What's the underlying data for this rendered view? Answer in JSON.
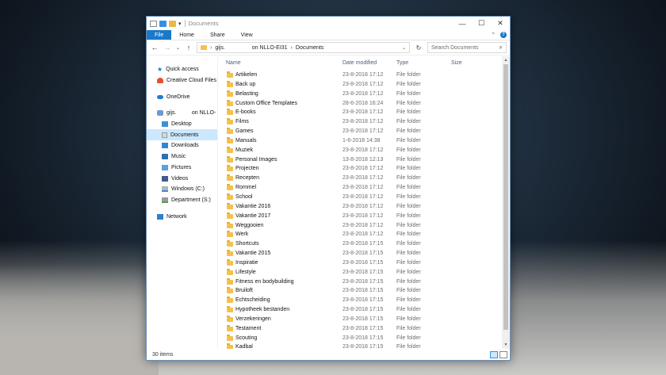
{
  "window": {
    "title": "Documents",
    "controls": {
      "minimize": "—",
      "maximize": "☐",
      "close": "✕"
    }
  },
  "ribbon": {
    "tabs": [
      "File",
      "Home",
      "Share",
      "View"
    ],
    "collapse": "⌃",
    "help": "?"
  },
  "address": {
    "back": "←",
    "forward": "→",
    "recent": "⌄",
    "up": "↑",
    "segments": [
      "gijs.",
      "on NLLO-EI31",
      "Documents"
    ],
    "dropdown": "⌄",
    "refresh": "↻",
    "search_placeholder": "Search Documents",
    "search_icon": "⌕"
  },
  "nav": {
    "items": [
      {
        "label": "Quick access",
        "icon": "star-icon"
      },
      {
        "label": "Creative Cloud Files",
        "icon": "creative-cloud-icon"
      },
      {
        "label": "OneDrive",
        "icon": "onedrive-icon"
      },
      {
        "label": "gijs.          on NLLO-",
        "icon": "user-folder-icon"
      },
      {
        "label": "Desktop",
        "icon": "desktop-icon"
      },
      {
        "label": "Documents",
        "icon": "documents-icon",
        "selected": true
      },
      {
        "label": "Downloads",
        "icon": "downloads-icon"
      },
      {
        "label": "Music",
        "icon": "music-icon"
      },
      {
        "label": "Pictures",
        "icon": "pictures-icon"
      },
      {
        "label": "Videos",
        "icon": "videos-icon"
      },
      {
        "label": "Windows (C:)",
        "icon": "drive-icon"
      },
      {
        "label": "Department (S:)",
        "icon": "network-drive-icon"
      },
      {
        "label": "Network",
        "icon": "network-icon"
      }
    ]
  },
  "columns": {
    "name": "Name",
    "date": "Date modified",
    "type": "Type",
    "size": "Size",
    "sort_indicator": "^"
  },
  "files": [
    {
      "name": "Artikelen",
      "date": "23-8-2018 17:12",
      "type": "File folder"
    },
    {
      "name": "Back up",
      "date": "23-8-2018 17:12",
      "type": "File folder"
    },
    {
      "name": "Belasting",
      "date": "23-8-2018 17:12",
      "type": "File folder"
    },
    {
      "name": "Custom Office Templates",
      "date": "28-6-2018 16:24",
      "type": "File folder"
    },
    {
      "name": "E-books",
      "date": "23-8-2018 17:12",
      "type": "File folder"
    },
    {
      "name": "Films",
      "date": "23-8-2018 17:12",
      "type": "File folder"
    },
    {
      "name": "Games",
      "date": "23-8-2018 17:12",
      "type": "File folder"
    },
    {
      "name": "Manuals",
      "date": "1-6-2018 14:38",
      "type": "File folder"
    },
    {
      "name": "Muziek",
      "date": "23-8-2018 17:12",
      "type": "File folder"
    },
    {
      "name": "Personal Images",
      "date": "13-8-2018 12:13",
      "type": "File folder"
    },
    {
      "name": "Projecten",
      "date": "23-8-2018 17:12",
      "type": "File folder"
    },
    {
      "name": "Recepten",
      "date": "23-8-2018 17:12",
      "type": "File folder"
    },
    {
      "name": "Rommel",
      "date": "23-8-2018 17:12",
      "type": "File folder"
    },
    {
      "name": "School",
      "date": "23-8-2018 17:12",
      "type": "File folder"
    },
    {
      "name": "Vakantie 2016",
      "date": "23-8-2018 17:12",
      "type": "File folder"
    },
    {
      "name": "Vakantie 2017",
      "date": "23-8-2018 17:12",
      "type": "File folder"
    },
    {
      "name": "Weggooien",
      "date": "23-8-2018 17:12",
      "type": "File folder"
    },
    {
      "name": "Werk",
      "date": "23-8-2018 17:12",
      "type": "File folder"
    },
    {
      "name": "Shortcuts",
      "date": "23-8-2018 17:15",
      "type": "File folder"
    },
    {
      "name": "Vakantie 2015",
      "date": "23-8-2018 17:15",
      "type": "File folder"
    },
    {
      "name": "Inspiratie",
      "date": "23-8-2018 17:15",
      "type": "File folder"
    },
    {
      "name": "Lifestyle",
      "date": "23-8-2018 17:15",
      "type": "File folder"
    },
    {
      "name": "Fitness en bodybuilding",
      "date": "23-8-2018 17:15",
      "type": "File folder"
    },
    {
      "name": "Bruiloft",
      "date": "23-8-2018 17:15",
      "type": "File folder"
    },
    {
      "name": "Echtscheiding",
      "date": "23-8-2018 17:15",
      "type": "File folder"
    },
    {
      "name": "Hypotheek bestanden",
      "date": "23-8-2018 17:15",
      "type": "File folder"
    },
    {
      "name": "Verzekeringen",
      "date": "23-8-2018 17:15",
      "type": "File folder"
    },
    {
      "name": "Testament",
      "date": "23-8-2018 17:15",
      "type": "File folder"
    },
    {
      "name": "Scouting",
      "date": "23-8-2018 17:15",
      "type": "File folder"
    },
    {
      "name": "Kadbal",
      "date": "23-8-2018 17:15",
      "type": "File folder"
    }
  ],
  "status": {
    "item_count": "30 items"
  }
}
